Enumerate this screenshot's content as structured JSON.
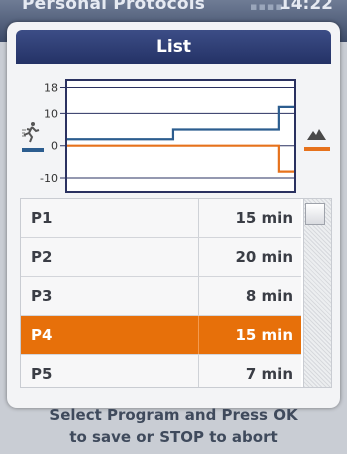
{
  "topbar": {
    "title": "Personal Protocols",
    "time": "14:22",
    "dots": "▪▪▪▪"
  },
  "dialog": {
    "title": "List"
  },
  "chart": {
    "y_ticks": [
      "18",
      "10",
      "0",
      "-10"
    ],
    "colors": {
      "speed": "#2c5d8f",
      "incline": "#e6721c"
    }
  },
  "programs": [
    {
      "name": "P1",
      "duration": "15 min"
    },
    {
      "name": "P2",
      "duration": "20 min"
    },
    {
      "name": "P3",
      "duration": "8 min"
    },
    {
      "name": "P4",
      "duration": "15 min"
    },
    {
      "name": "P5",
      "duration": "7 min"
    }
  ],
  "selected_index": 3,
  "footer": {
    "line1": "Select Program and Press OK",
    "line2": "to save or STOP to abort"
  },
  "chart_data": {
    "type": "line",
    "x": [
      0,
      1,
      2,
      3,
      4,
      5,
      6,
      7,
      8,
      9,
      10,
      11,
      12,
      13,
      14,
      15
    ],
    "series": [
      {
        "values": [
          2,
          2,
          2,
          2,
          2,
          2,
          2,
          5,
          5,
          5,
          5,
          5,
          5,
          5,
          12,
          12
        ]
      },
      {
        "values": [
          0,
          0,
          0,
          0,
          0,
          0,
          0,
          0,
          0,
          0,
          0,
          0,
          0,
          0,
          -8,
          -8
        ]
      }
    ],
    "ylim": [
      -14,
      20
    ],
    "yticks": [
      18,
      10,
      0,
      -10
    ],
    "xlabel": "",
    "ylabel": ""
  }
}
